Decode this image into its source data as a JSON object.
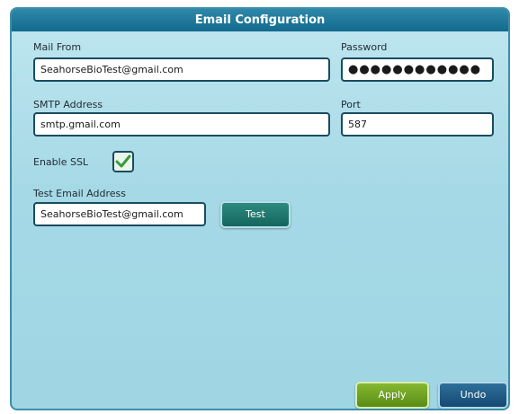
{
  "dialog": {
    "title": "Email Configuration"
  },
  "fields": {
    "mail_from": {
      "label": "Mail From",
      "value": "SeahorseBioTest@gmail.com"
    },
    "password": {
      "label": "Password",
      "value": "●●●●●●●●●●●●"
    },
    "smtp_address": {
      "label": "SMTP Address",
      "value": "smtp.gmail.com"
    },
    "port": {
      "label": "Port",
      "value": "587"
    },
    "enable_ssl": {
      "label": "Enable SSL",
      "checked": true
    },
    "test_email": {
      "label": "Test Email Address",
      "value": "SeahorseBioTest@gmail.com"
    }
  },
  "buttons": {
    "test": "Test",
    "apply": "Apply",
    "undo": "Undo"
  },
  "icons": {
    "checkbox_check": "check-icon"
  },
  "colors": {
    "title_bar": "#126a8e",
    "apply": "#6a9e1c",
    "undo": "#1b5580",
    "test": "#1a6f64",
    "check": "#3a9a3a"
  }
}
